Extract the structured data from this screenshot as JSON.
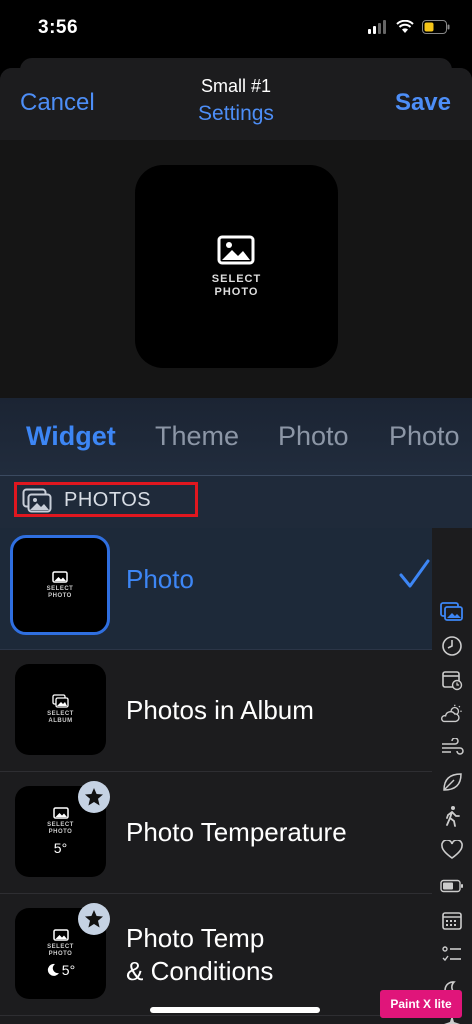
{
  "status_bar": {
    "time": "3:56"
  },
  "nav": {
    "cancel_label": "Cancel",
    "title": "Small #1",
    "subtitle": "Settings",
    "save_label": "Save"
  },
  "preview": {
    "caption_line1": "SELECT",
    "caption_line2": "PHOTO"
  },
  "tabs": [
    {
      "label": "Widget",
      "active": true
    },
    {
      "label": "Theme",
      "active": false
    },
    {
      "label": "Photo",
      "active": false
    },
    {
      "label": "Photo",
      "active": false
    }
  ],
  "section": {
    "label": "PHOTOS",
    "icon": "photos-stack-icon"
  },
  "rows": [
    {
      "label": "Photo",
      "thumb_caption_1": "SELECT",
      "thumb_caption_2": "PHOTO",
      "selected": true
    },
    {
      "label": "Photos in Album",
      "thumb_caption_1": "SELECT",
      "thumb_caption_2": "ALBUM",
      "selected": false
    },
    {
      "label": "Photo Temperature",
      "thumb_caption_1": "SELECT",
      "thumb_caption_2": "PHOTO",
      "thumb_temp": "5°",
      "premium": true
    },
    {
      "label_line1": "Photo Temp",
      "label_line2": "& Conditions",
      "thumb_caption_1": "SELECT",
      "thumb_caption_2": "PHOTO",
      "thumb_temp": "5°",
      "premium": true
    }
  ],
  "index_icons": [
    "photos-icon",
    "clock-icon",
    "calendar-icon",
    "weather-icon",
    "wind-icon",
    "leaf-icon",
    "walking-icon",
    "heart-icon",
    "battery-icon",
    "calendar-grid-icon",
    "checklist-icon",
    "moon-icon",
    "sparkles-icon"
  ],
  "colors": {
    "accent": "#3d86f5",
    "highlight_box": "#e0171f",
    "selected_row": "#1d2939"
  },
  "watermark": "Paint X lite"
}
